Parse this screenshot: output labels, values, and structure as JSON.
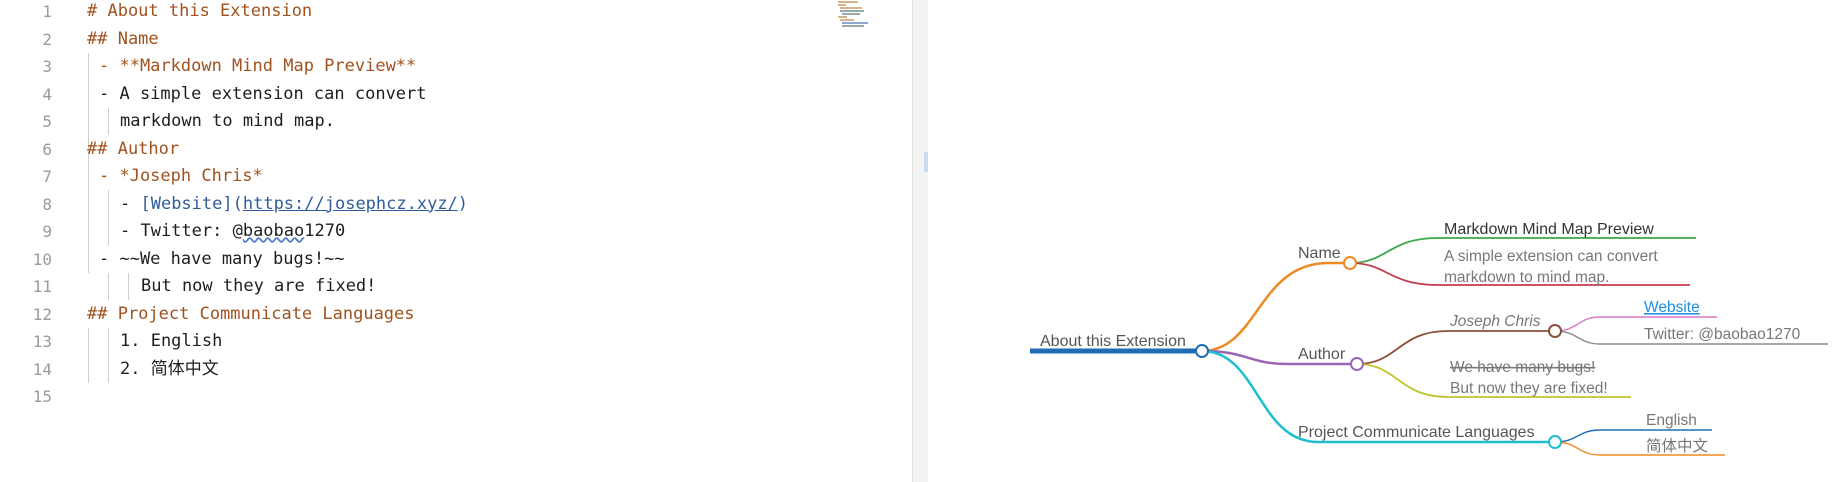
{
  "editor": {
    "line_numbers": [
      "1",
      "2",
      "3",
      "4",
      "5",
      "6",
      "7",
      "8",
      "9",
      "10",
      "11",
      "12",
      "13",
      "14",
      "15"
    ],
    "lines": {
      "l1": "# About this Extension",
      "l2": "## Name",
      "l3": "- **Markdown Mind Map Preview**",
      "l4": "- A simple extension can convert",
      "l5": "markdown to mind map.",
      "l6": "## Author",
      "l7": "- *Joseph Chris*",
      "l8_dash": "- ",
      "l8_label": "[Website]",
      "l8_paren_open": "(",
      "l8_url": "https://josephcz.xyz/",
      "l8_paren_close": ")",
      "l9_prefix": "- Twitter: @",
      "l9_handle": "baobao",
      "l9_suffix": "1270",
      "l10": "- ~~We have many bugs!~~",
      "l11": "But now they are fixed!",
      "l12": "## Project Communicate Languages",
      "l13": "1. English",
      "l14": "2. 简体中文"
    }
  },
  "mindmap": {
    "root": "About this Extension",
    "name": "Name",
    "name_title": "Markdown Mind Map Preview",
    "name_desc_1": "A simple extension can convert",
    "name_desc_2": "markdown to mind map.",
    "author": "Author",
    "author_name": "Joseph Chris",
    "website": "Website",
    "twitter": "Twitter: @baobao1270",
    "bugs": "We have many bugs!",
    "fixed": "But now they are fixed!",
    "languages": "Project Communicate Languages",
    "english": "English",
    "chinese": "简体中文"
  },
  "colors": {
    "root": "#1f6eb3",
    "name": "#f08a24",
    "name_title": "#3aa84a",
    "name_desc": "#c53c4e",
    "author": "#9c65b7",
    "author_name": "#8b4f3c",
    "website": "#d979c4",
    "twitter": "#8c8c8c",
    "bugs": "#c0c22e",
    "languages": "#1ebecf",
    "english": "#1f6eb3",
    "chinese": "#f08a24"
  }
}
